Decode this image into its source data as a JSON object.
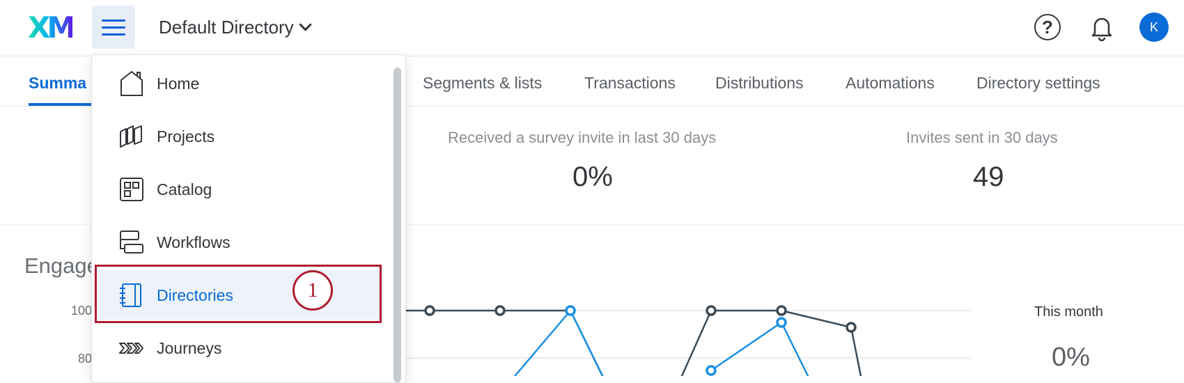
{
  "header": {
    "logo_text": "XM",
    "directory_label": "Default Directory",
    "help_symbol": "?",
    "avatar_initial": "K",
    "icons": [
      "menu-icon",
      "chevron-down-icon",
      "help-icon",
      "bell-icon"
    ]
  },
  "tabs": [
    {
      "label": "Summa",
      "active": true
    },
    {
      "label": "Segments & lists"
    },
    {
      "label": "Transactions"
    },
    {
      "label": "Distributions"
    },
    {
      "label": "Automations"
    },
    {
      "label": "Directory settings"
    }
  ],
  "stats": [
    {
      "label": "Received a survey invite in last 30 days",
      "value": "0%"
    },
    {
      "label": "Invites sent in 30 days",
      "value": "49"
    }
  ],
  "engagement": {
    "title": "Engage",
    "y_ticks": [
      "100",
      "80"
    ],
    "this_month_label": "This month",
    "this_month_value": "0%"
  },
  "nav_menu": {
    "items": [
      {
        "label": "Home",
        "icon": "home-icon"
      },
      {
        "label": "Projects",
        "icon": "projects-icon"
      },
      {
        "label": "Catalog",
        "icon": "catalog-icon"
      },
      {
        "label": "Workflows",
        "icon": "workflows-icon"
      },
      {
        "label": "Directories",
        "icon": "directories-icon",
        "selected": true
      },
      {
        "label": "Journeys",
        "icon": "journeys-icon"
      }
    ]
  },
  "annotation": {
    "step": "1",
    "color": "#b01c2e"
  },
  "colors": {
    "accent": "#0b6bd6",
    "dark_series": "#3d4a55",
    "blue_series": "#1a8fe3"
  }
}
